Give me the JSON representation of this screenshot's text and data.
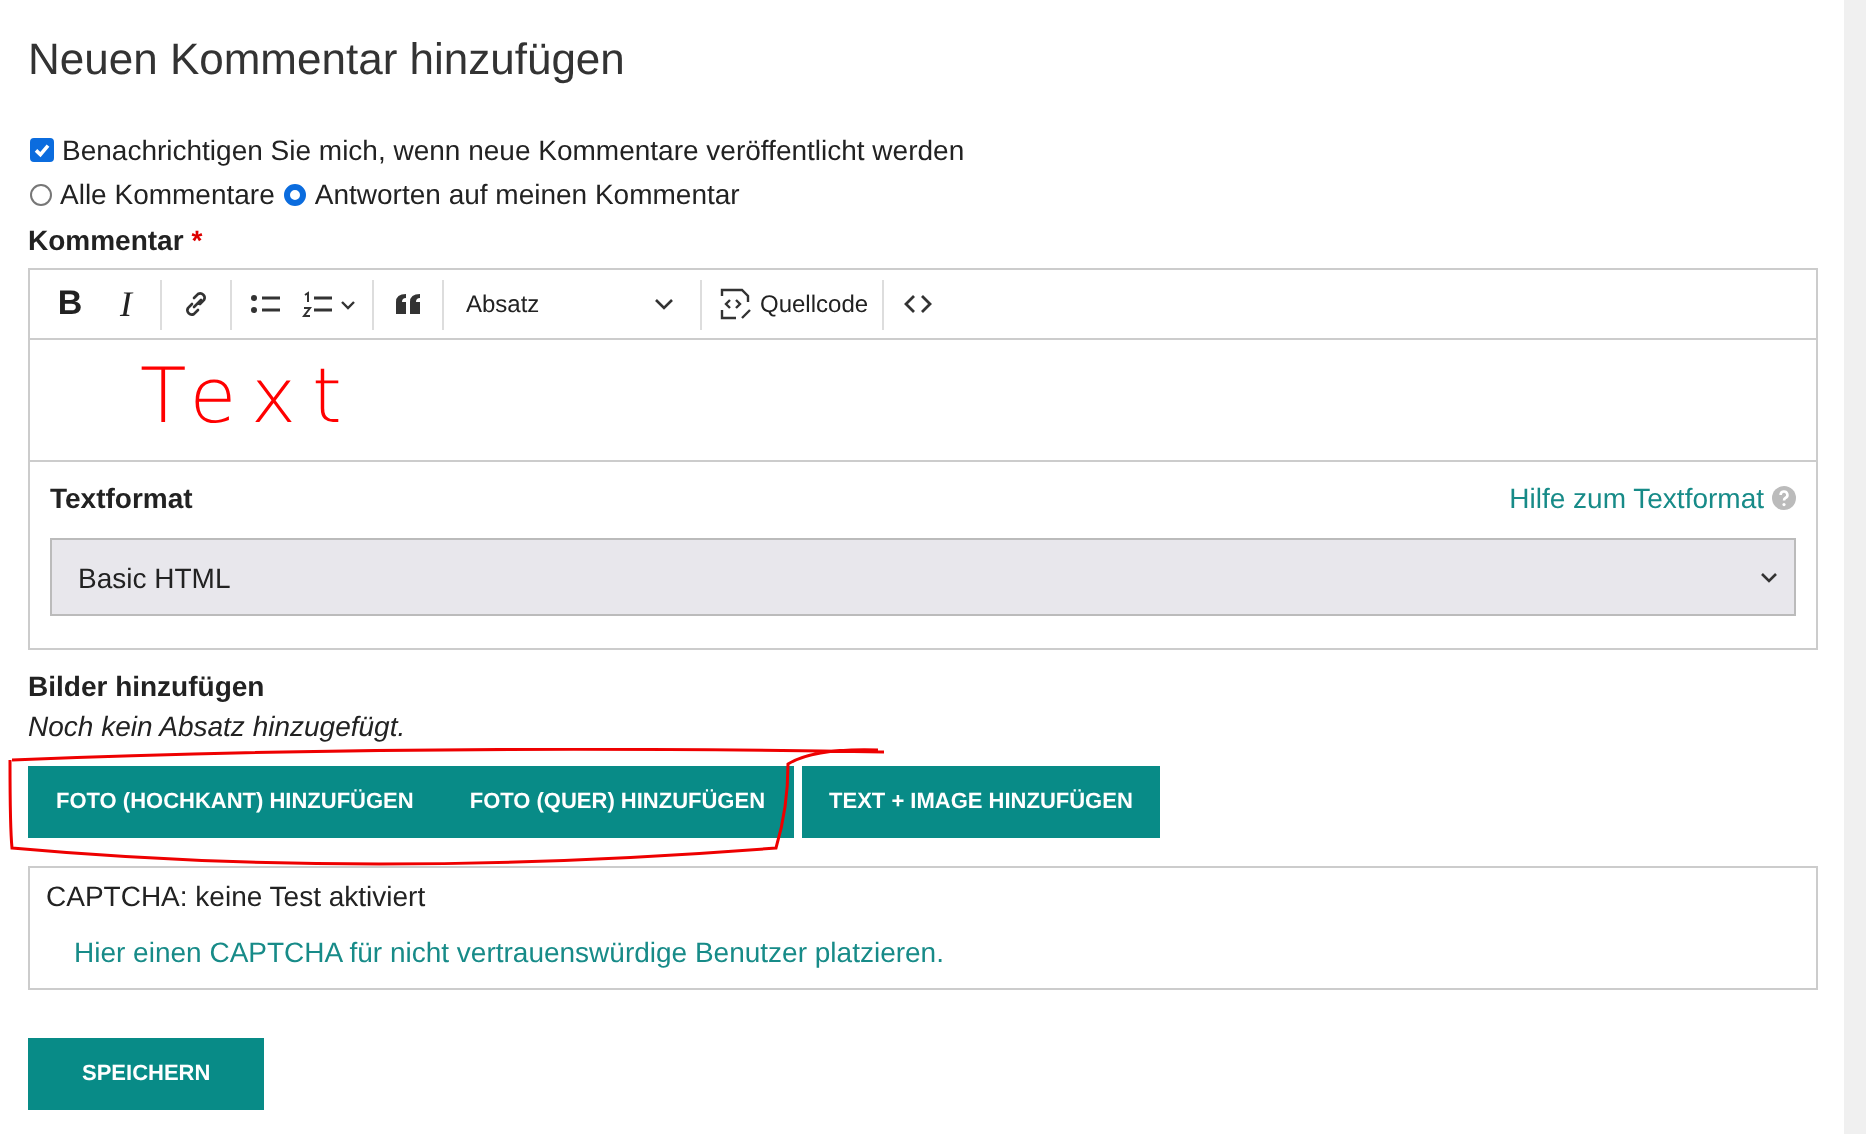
{
  "title": "Neuen Kommentar hinzufügen",
  "notify": {
    "label": "Benachrichtigen Sie mich, wenn neue Kommentare veröffentlicht werden",
    "checked": true
  },
  "notify_options": [
    {
      "label": "Alle Kommentare",
      "selected": false
    },
    {
      "label": "Antworten auf meinen Kommentar",
      "selected": true
    }
  ],
  "comment": {
    "label": "Kommentar",
    "required_mark": "*",
    "toolbar_groups": [
      [
        {
          "kind": "bold",
          "label": "B"
        },
        {
          "kind": "italic",
          "label": "I"
        }
      ],
      [
        {
          "kind": "link"
        }
      ],
      [
        {
          "kind": "bullet-list"
        },
        {
          "kind": "numbered-list"
        }
      ],
      [
        {
          "kind": "quote"
        }
      ],
      [
        {
          "kind": "select",
          "label": "Absatz"
        }
      ],
      [
        {
          "kind": "source",
          "label": "Quellcode"
        }
      ],
      [
        {
          "kind": "code"
        }
      ]
    ],
    "handwritten_note": "Text",
    "format_label": "Textformat",
    "format_help": "Hilfe zum Textformat",
    "format_value": "Basic HTML"
  },
  "images": {
    "label": "Bilder hinzufügen",
    "empty_note": "Noch kein Absatz hinzugefügt.",
    "button_groups": [
      [
        "FOTO (HOCHKANT) HINZUFÜGEN",
        "FOTO (QUER) HINZUFÜGEN"
      ],
      [
        "TEXT + IMAGE HINZUFÜGEN"
      ]
    ]
  },
  "captcha": {
    "title": "CAPTCHA: keine Test aktiviert",
    "link": "Hier einen CAPTCHA für nicht vertrauenswürdige Benutzer platzieren."
  },
  "save": "SPEICHERN"
}
